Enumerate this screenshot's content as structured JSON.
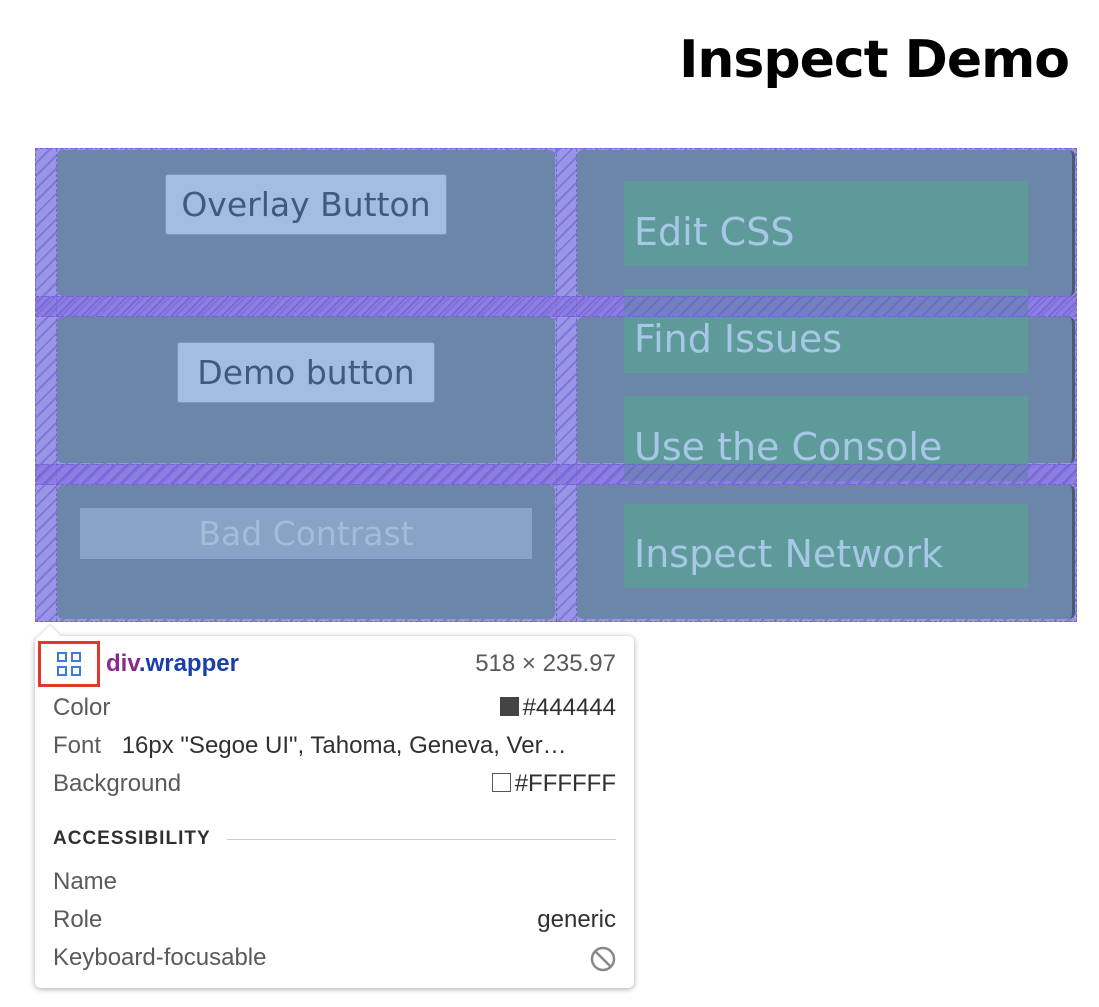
{
  "page": {
    "title": "Inspect Demo"
  },
  "grid": {
    "left_buttons": [
      "Overlay Button",
      "Demo button"
    ],
    "bad_contrast_label": "Bad Contrast",
    "right_items": [
      "Edit CSS",
      "Find Issues",
      "Use the Console",
      "Inspect Network"
    ]
  },
  "tooltip": {
    "icon": "grid-layout-icon",
    "selector_tag": "div",
    "selector_class": ".wrapper",
    "size": "518 × 235.97",
    "color_label": "Color",
    "color_value": "#444444",
    "font_label": "Font",
    "font_value": "16px \"Segoe UI\", Tahoma, Geneva, Ver…",
    "background_label": "Background",
    "background_value": "#FFFFFF",
    "accessibility_heading": "ACCESSIBILITY",
    "name_label": "Name",
    "role_label": "Role",
    "role_value": "generic",
    "keyboard_label": "Keyboard-focusable",
    "keyboard_icon": "not-allowed-icon"
  },
  "colors": {
    "overlay": "#9a96e6",
    "cell": "#6b86a8",
    "green_box": "#5f9a9a",
    "color_swatch": "#444444",
    "background_swatch": "#FFFFFF",
    "highlight_border": "#e0392b"
  }
}
